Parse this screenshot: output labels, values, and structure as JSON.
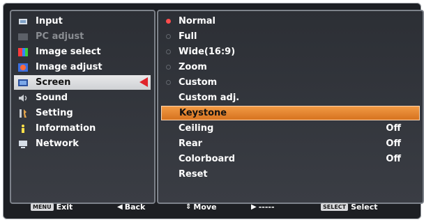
{
  "left_menu": {
    "items": [
      {
        "label": "Input",
        "icon": "input-icon",
        "state": "normal"
      },
      {
        "label": "PC adjust",
        "icon": "pc-adjust-icon",
        "state": "disabled"
      },
      {
        "label": "Image select",
        "icon": "image-select-icon",
        "state": "normal"
      },
      {
        "label": "Image adjust",
        "icon": "image-adjust-icon",
        "state": "normal"
      },
      {
        "label": "Screen",
        "icon": "screen-icon",
        "state": "selected"
      },
      {
        "label": "Sound",
        "icon": "sound-icon",
        "state": "normal"
      },
      {
        "label": "Setting",
        "icon": "setting-icon",
        "state": "normal"
      },
      {
        "label": "Information",
        "icon": "information-icon",
        "state": "normal"
      },
      {
        "label": "Network",
        "icon": "network-icon",
        "state": "normal"
      }
    ]
  },
  "right_menu": {
    "items": [
      {
        "label": "Normal",
        "radio": "on",
        "value": ""
      },
      {
        "label": "Full",
        "radio": "off",
        "value": ""
      },
      {
        "label": "Wide(16:9)",
        "radio": "off",
        "value": ""
      },
      {
        "label": "Zoom",
        "radio": "off",
        "value": ""
      },
      {
        "label": "Custom",
        "radio": "off",
        "value": ""
      },
      {
        "label": "Custom adj.",
        "radio": "none",
        "value": ""
      },
      {
        "label": "Keystone",
        "radio": "none",
        "value": "",
        "highlight": true
      },
      {
        "label": "Ceiling",
        "radio": "none",
        "value": "Off"
      },
      {
        "label": "Rear",
        "radio": "none",
        "value": "Off"
      },
      {
        "label": "Colorboard",
        "radio": "none",
        "value": "Off"
      },
      {
        "label": "Reset",
        "radio": "none",
        "value": ""
      }
    ]
  },
  "footer": {
    "exit_badge": "MENU",
    "exit_label": "Exit",
    "back_glyph": "◀",
    "back_label": "Back",
    "move_glyph": "⇕",
    "move_label": "Move",
    "next_glyph": "▶",
    "next_label": "-----",
    "select_badge": "SELECT",
    "select_label": "Select"
  },
  "colors": {
    "highlight": "#e07f2a",
    "selected_arrow": "#e0242b",
    "radio_on": "#ff4d4d"
  }
}
